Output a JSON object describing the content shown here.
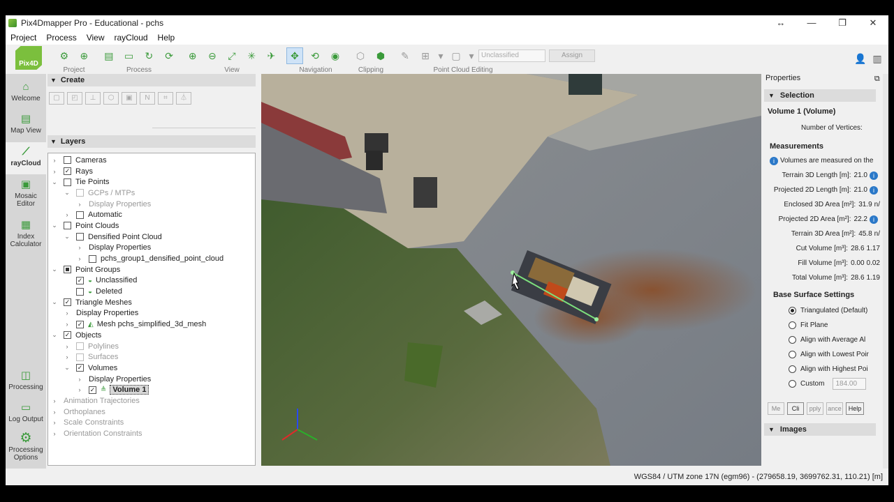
{
  "window": {
    "title": "Pix4Dmapper Pro - Educational - pchs",
    "controls": [
      "↔",
      "—",
      "❐",
      "✕"
    ]
  },
  "menu": [
    "Project",
    "Process",
    "View",
    "rayCloud",
    "Help"
  ],
  "brand": "Pix4D",
  "toolbar": {
    "groups": [
      {
        "label": "Project",
        "icons": [
          "project-open-icon",
          "project-target-icon"
        ]
      },
      {
        "label": "Process",
        "icons": [
          "process-doc-icon",
          "process-folder-icon",
          "process-refresh-icon",
          "process-rerun-icon"
        ]
      },
      {
        "label": "View",
        "icons": [
          "zoom-in-icon",
          "zoom-out-icon",
          "zoom-fit-icon",
          "zoom-extent-icon",
          "fly-icon"
        ]
      },
      {
        "label": "Navigation",
        "icons": [
          "navigation-move-icon",
          "navigation-rotate-icon",
          "navigation-eye-icon"
        ]
      },
      {
        "label": "Clipping",
        "icons": [
          "clipping-box-icon",
          "clipping-box2-icon"
        ]
      }
    ],
    "editing_label": "Point Cloud Editing",
    "class_select": "Unclassified",
    "assign_label": "Assign"
  },
  "leftnav": [
    {
      "label": "Welcome",
      "icon": "home-icon"
    },
    {
      "label": "Map View",
      "icon": "map-icon"
    },
    {
      "label": "rayCloud",
      "icon": "raycloud-icon",
      "active": true
    },
    {
      "label": "Mosaic Editor",
      "icon": "mosaic-icon"
    },
    {
      "label": "Index Calculator",
      "icon": "index-calculator-icon"
    },
    {
      "label": "Processing",
      "icon": "processing-icon"
    },
    {
      "label": "Log Output",
      "icon": "log-icon"
    },
    {
      "label": "Processing Options",
      "icon": "gear-icon"
    }
  ],
  "create": {
    "title": "Create"
  },
  "layers": {
    "title": "Layers",
    "items": [
      {
        "label": "Cameras",
        "indent": 0,
        "exp": "›",
        "cb": "off"
      },
      {
        "label": "Rays",
        "indent": 0,
        "exp": "›",
        "cb": "on"
      },
      {
        "label": "Tie Points",
        "indent": 0,
        "exp": "⌄",
        "cb": "off"
      },
      {
        "label": "GCPs / MTPs",
        "indent": 1,
        "exp": "⌄",
        "cb": "grey",
        "dim": true
      },
      {
        "label": "Display Properties",
        "indent": 2,
        "exp": "›",
        "cb": "none",
        "dim": true
      },
      {
        "label": "Automatic",
        "indent": 1,
        "exp": "›",
        "cb": "off"
      },
      {
        "label": "Point Clouds",
        "indent": 0,
        "exp": "⌄",
        "cb": "off"
      },
      {
        "label": "Densified Point Cloud",
        "indent": 1,
        "exp": "⌄",
        "cb": "off"
      },
      {
        "label": "Display Properties",
        "indent": 2,
        "exp": "›",
        "cb": "none"
      },
      {
        "label": "pchs_group1_densified_point_cloud",
        "indent": 2,
        "exp": "›",
        "cb": "off"
      },
      {
        "label": "Point Groups",
        "indent": 0,
        "exp": "⌄",
        "cb": "part"
      },
      {
        "label": "Unclassified",
        "indent": 1,
        "exp": "",
        "cb": "on",
        "mini": "◒"
      },
      {
        "label": "Deleted",
        "indent": 1,
        "exp": "",
        "cb": "off",
        "mini": "◒"
      },
      {
        "label": "Triangle Meshes",
        "indent": 0,
        "exp": "⌄",
        "cb": "on"
      },
      {
        "label": "Display Properties",
        "indent": 1,
        "exp": "›",
        "cb": "none"
      },
      {
        "label": "Mesh pchs_simplified_3d_mesh",
        "indent": 1,
        "exp": "›",
        "cb": "on",
        "mini": "◭"
      },
      {
        "label": "Objects",
        "indent": 0,
        "exp": "⌄",
        "cb": "on"
      },
      {
        "label": "Polylines",
        "indent": 1,
        "exp": "›",
        "cb": "grey",
        "dim": true
      },
      {
        "label": "Surfaces",
        "indent": 1,
        "exp": "›",
        "cb": "grey",
        "dim": true
      },
      {
        "label": "Volumes",
        "indent": 1,
        "exp": "⌄",
        "cb": "on"
      },
      {
        "label": "Display Properties",
        "indent": 2,
        "exp": "›",
        "cb": "none"
      },
      {
        "label": "Volume 1",
        "indent": 2,
        "exp": "›",
        "cb": "on",
        "mini": "≜",
        "selected": true
      },
      {
        "label": "Animation Trajectories",
        "indent": 0,
        "exp": "›",
        "cb": "none",
        "dim": true
      },
      {
        "label": "Orthoplanes",
        "indent": 0,
        "exp": "›",
        "cb": "none",
        "dim": true
      },
      {
        "label": "Scale Constraints",
        "indent": 0,
        "exp": "›",
        "cb": "none",
        "dim": true
      },
      {
        "label": "Orientation Constraints",
        "indent": 0,
        "exp": "›",
        "cb": "none",
        "dim": true
      }
    ]
  },
  "properties": {
    "title": "Properties",
    "selection_title": "Selection",
    "object_title": "Volume 1 (Volume)",
    "vertices_label": "Number of Vertices:",
    "measurements_title": "Measurements",
    "info_text": "Volumes are measured on the",
    "measurements": [
      {
        "label": "Terrain 3D Length [m]:",
        "value": "21.0",
        "info": true
      },
      {
        "label": "Projected 2D Length [m]:",
        "value": "21.0",
        "info": true
      },
      {
        "label": "Enclosed 3D Area [m²]:",
        "value": "31.9",
        "suffix": "n/"
      },
      {
        "label": "Projected 2D Area [m²]:",
        "value": "22.2",
        "info": true
      },
      {
        "label": "Terrain 3D Area [m²]:",
        "value": "45.8",
        "suffix": "n/"
      },
      {
        "label": "Cut Volume [m³]:",
        "value": "28.6",
        "suffix": "1.17"
      },
      {
        "label": "Fill Volume [m³]:",
        "value": "0.00",
        "suffix": "0.02"
      },
      {
        "label": "Total Volume [m³]:",
        "value": "28.6",
        "suffix": "1.19"
      }
    ],
    "base_title": "Base Surface Settings",
    "base_options": [
      {
        "label": "Triangulated (Default)",
        "on": true
      },
      {
        "label": "Fit Plane",
        "on": false
      },
      {
        "label": "Align with Average Al",
        "on": false
      },
      {
        "label": "Align with Lowest Poir",
        "on": false
      },
      {
        "label": "Align with Highest Poi",
        "on": false
      },
      {
        "label": "Custom",
        "on": false
      }
    ],
    "custom_value": "184.00",
    "buttons": [
      "Me",
      "Cli",
      "pply",
      "ance",
      "Help"
    ],
    "images_title": "Images"
  },
  "status": "WGS84 / UTM zone 17N (egm96) - (279658.19, 3699762.31, 110.21) [m]"
}
